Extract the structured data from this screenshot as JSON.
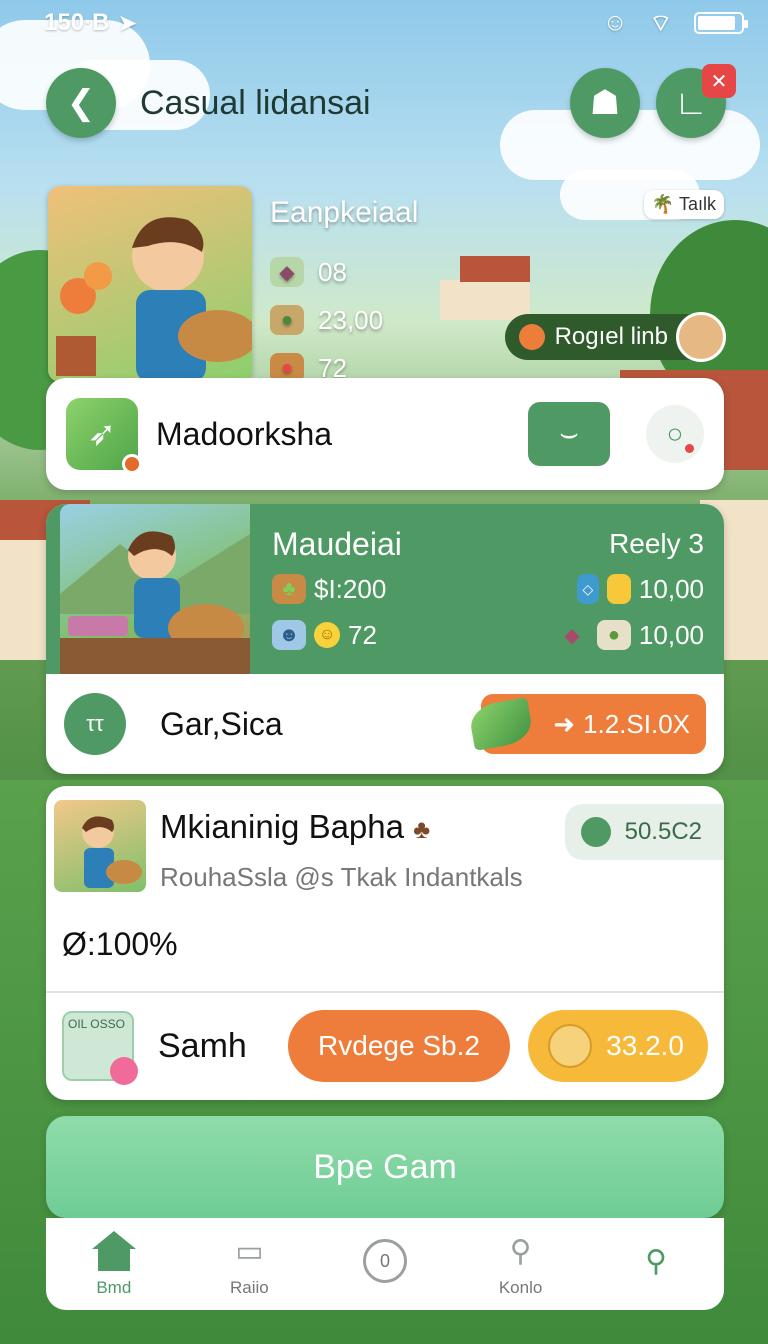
{
  "status_bar": {
    "time": "150·B",
    "location_icon": "navigation-arrow-icon"
  },
  "header": {
    "title": "Casual lidansai"
  },
  "hero": {
    "heading": "Eanpkeiaal",
    "stats": [
      "08",
      "23,00",
      "72"
    ],
    "talk_tag": "Taılk",
    "pill_label": "Rogıel linb"
  },
  "card1": {
    "name": "Madoorksha"
  },
  "card2": {
    "title": "Maudeiai",
    "reely": "Reely 3",
    "price": "$I:200",
    "count": "72",
    "value1": "10,00",
    "value2": "10,00",
    "bottom_name": "Gar,Sica",
    "doc_icon_text": "ττ",
    "button_label": "1.2.SI.0X"
  },
  "card3": {
    "title": "Mkianinig Bapha",
    "subtitle": "RouhaSsla @s Tkak Indantkals",
    "chip_value": "50.5C2",
    "percent": "Ø:100%",
    "calendar_text": "OIL OSSO",
    "bottom_name": "Samh",
    "orange_pill": "Rvdege Sb.2",
    "yellow_pill": "33.2.0"
  },
  "cta": {
    "label": "Bpe Gam"
  },
  "tabs": [
    {
      "label": "Bmd",
      "icon": "home-icon"
    },
    {
      "label": "Raiio",
      "icon": "radio-icon"
    },
    {
      "label": "",
      "icon": "zero-ring-icon",
      "glyph": "0"
    },
    {
      "label": "Konlo",
      "icon": "search-icon"
    },
    {
      "label": "",
      "icon": "search-icon-green"
    }
  ],
  "colors": {
    "primary_green": "#4f9a64",
    "orange": "#ee7d3b",
    "yellow": "#f7b93a",
    "danger": "#e64646"
  }
}
